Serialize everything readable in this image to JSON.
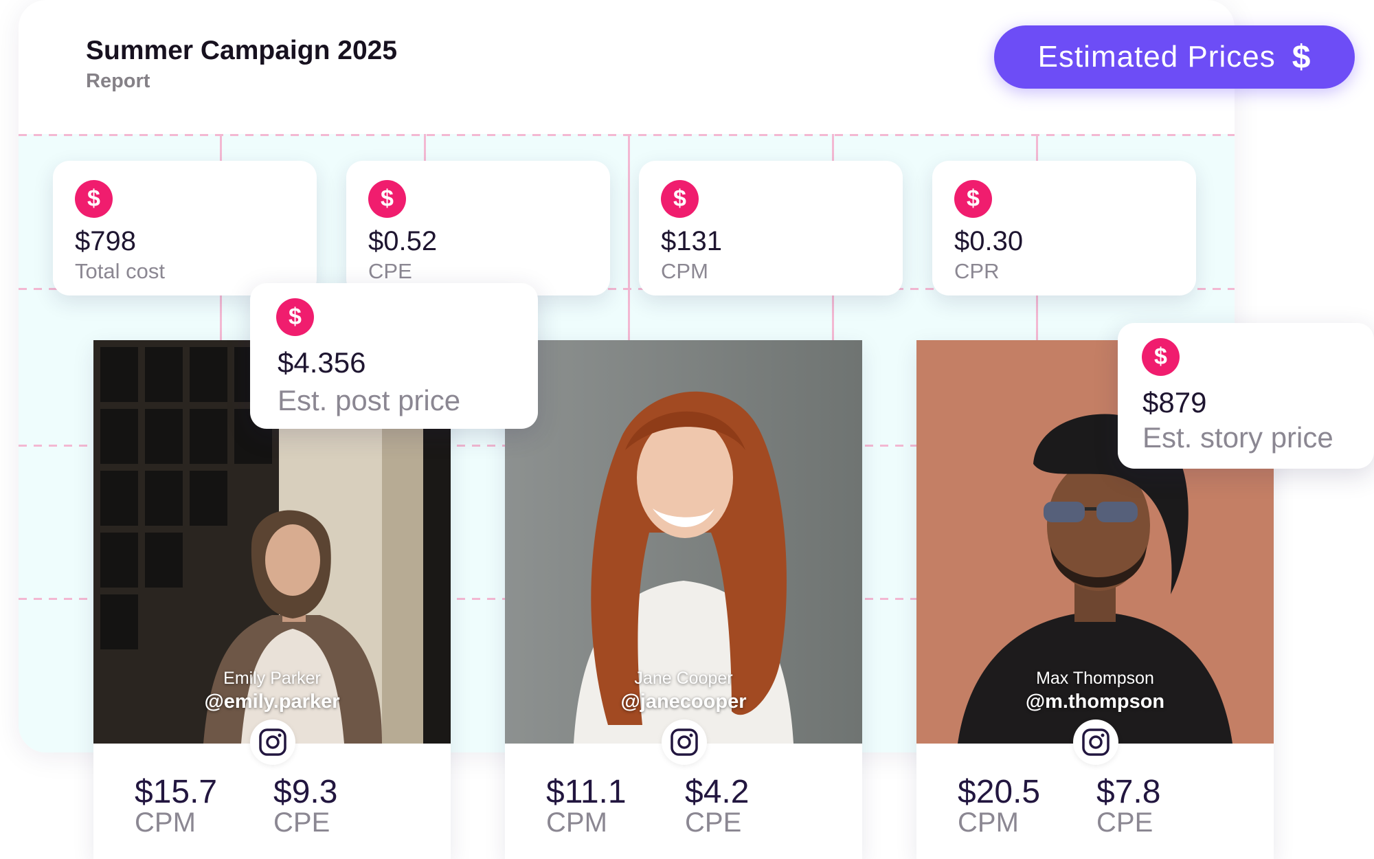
{
  "header": {
    "title": "Summer Campaign 2025",
    "subtitle": "Report",
    "estimate_button_label": "Estimated Prices",
    "estimate_button_icon": "$"
  },
  "icon_glyph": "$",
  "colors": {
    "accent": "#6d4df6",
    "dollar_icon": "#f01d6e",
    "grid_background": "#effdfd",
    "grid_lines": "#f3b8d2"
  },
  "stats": [
    {
      "value": "$798",
      "label": "Total cost"
    },
    {
      "value": "$0.52",
      "label": "CPE"
    },
    {
      "value": "$131",
      "label": "CPM"
    },
    {
      "value": "$0.30",
      "label": "CPR"
    }
  ],
  "popups": {
    "post": {
      "value": "$4.356",
      "label": "Est. post price"
    },
    "story": {
      "value": "$879",
      "label": "Est. story price"
    }
  },
  "influencers": [
    {
      "name": "Emily Parker",
      "handle": "@emily.parker",
      "platform_icon": "instagram-icon",
      "metrics": [
        {
          "value": "$15.7",
          "label": "CPM"
        },
        {
          "value": "$9.3",
          "label": "CPE"
        }
      ]
    },
    {
      "name": "Jane Cooper",
      "handle": "@janecooper",
      "platform_icon": "instagram-icon",
      "metrics": [
        {
          "value": "$11.1",
          "label": "CPM"
        },
        {
          "value": "$4.2",
          "label": "CPE"
        }
      ]
    },
    {
      "name": "Max Thompson",
      "handle": "@m.thompson",
      "platform_icon": "instagram-icon",
      "metrics": [
        {
          "value": "$20.5",
          "label": "CPM"
        },
        {
          "value": "$7.8",
          "label": "CPE"
        }
      ]
    }
  ]
}
